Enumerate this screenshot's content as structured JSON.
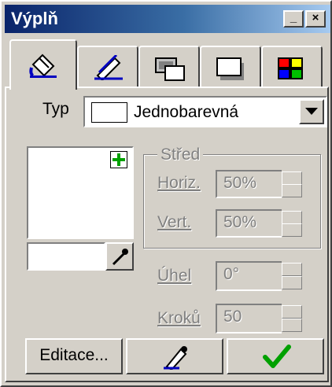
{
  "window": {
    "title": "Výplň"
  },
  "titlebar_buttons": {
    "minimize": "_",
    "close": "×"
  },
  "tabs": [
    {
      "name": "fill-tab",
      "icon": "paint-bucket-icon"
    },
    {
      "name": "outline-tab",
      "icon": "pen-icon"
    },
    {
      "name": "transparency-tab",
      "icon": "overlapping-rectangles-icon"
    },
    {
      "name": "shadow-tab",
      "icon": "shadow-rectangle-icon"
    },
    {
      "name": "palette-tab",
      "icon": "color-grid-icon"
    }
  ],
  "type": {
    "label": "Typ",
    "value": "Jednobarevná"
  },
  "center": {
    "group_label": "Střed",
    "horiz": {
      "label": "Horiz.",
      "underline": "H",
      "value": "50%"
    },
    "vert": {
      "label": "Vert.",
      "underline": "V",
      "value": "50%"
    }
  },
  "angle": {
    "label": "Úhel",
    "underline": "Ú",
    "value": "0°"
  },
  "steps": {
    "label": "Kroků",
    "underline": "K",
    "value": "50"
  },
  "buttons": {
    "edit": "Editace..."
  },
  "colors": {
    "titlebar_start": "#0a246a",
    "face": "#d4d0c8",
    "check": "#00a000",
    "plus": "#00a000"
  }
}
